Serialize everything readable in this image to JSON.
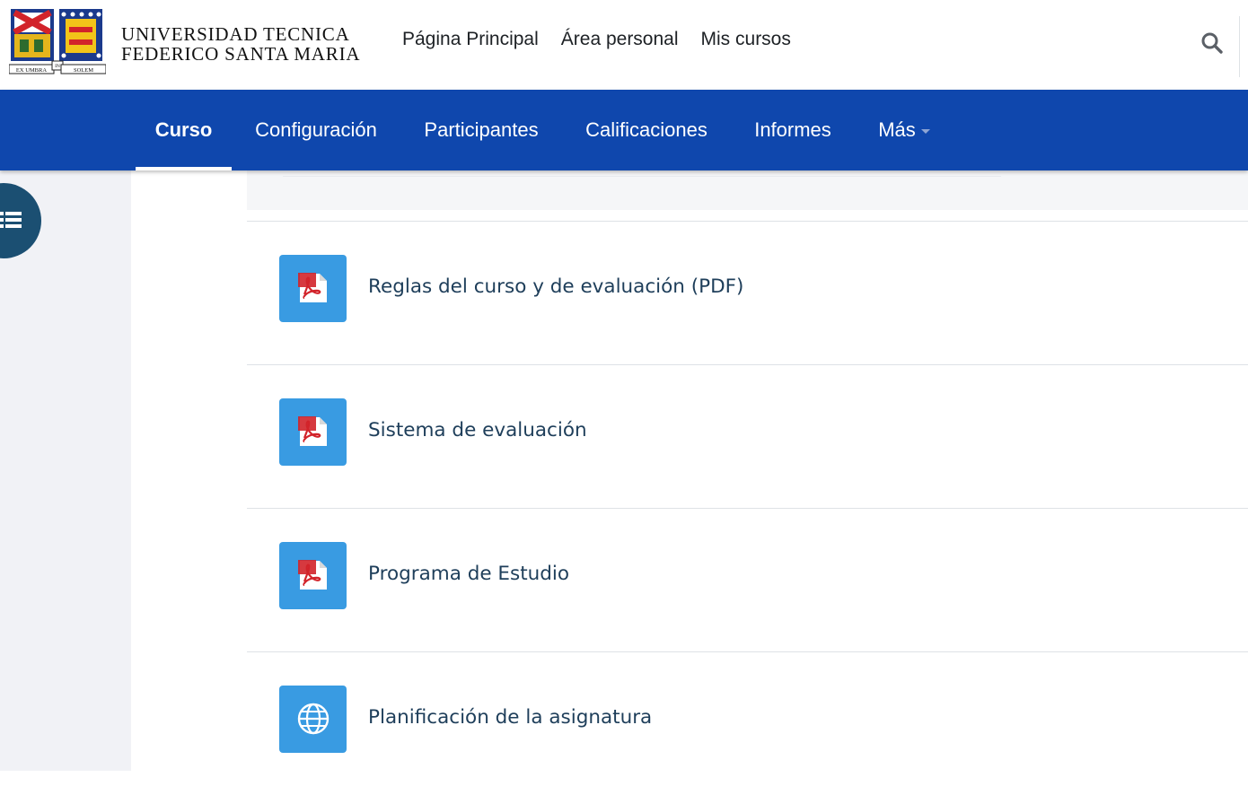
{
  "header": {
    "brand_line1": "UNIVERSIDAD TECNICA",
    "brand_line2": "FEDERICO SANTA MARIA",
    "logo_motto_left": "EX UMBRA",
    "logo_motto_mid": "IN",
    "logo_motto_right": "SOLEM",
    "nav": [
      {
        "label": "Página Principal"
      },
      {
        "label": "Área personal"
      },
      {
        "label": "Mis cursos"
      }
    ],
    "search_icon": "search-icon"
  },
  "course_nav": {
    "tabs": [
      {
        "label": "Curso",
        "active": true
      },
      {
        "label": "Configuración"
      },
      {
        "label": "Participantes"
      },
      {
        "label": "Calificaciones"
      },
      {
        "label": "Informes"
      },
      {
        "label": "Más",
        "has_dropdown": true
      }
    ]
  },
  "drawer": {
    "toggle_icon": "list-icon"
  },
  "activities": [
    {
      "name": "Reglas del curso y de evaluación (PDF)",
      "icon": "pdf-icon"
    },
    {
      "name": "Sistema de evaluación",
      "icon": "pdf-icon"
    },
    {
      "name": "Programa de Estudio",
      "icon": "pdf-icon"
    },
    {
      "name": "Planificación de la asignatura",
      "icon": "globe-icon"
    }
  ],
  "colors": {
    "nav_blue": "#0f47ad",
    "activity_icon_bg": "#399be2",
    "drawer_toggle": "#1b4f72",
    "link_text": "#1e3e5a"
  }
}
